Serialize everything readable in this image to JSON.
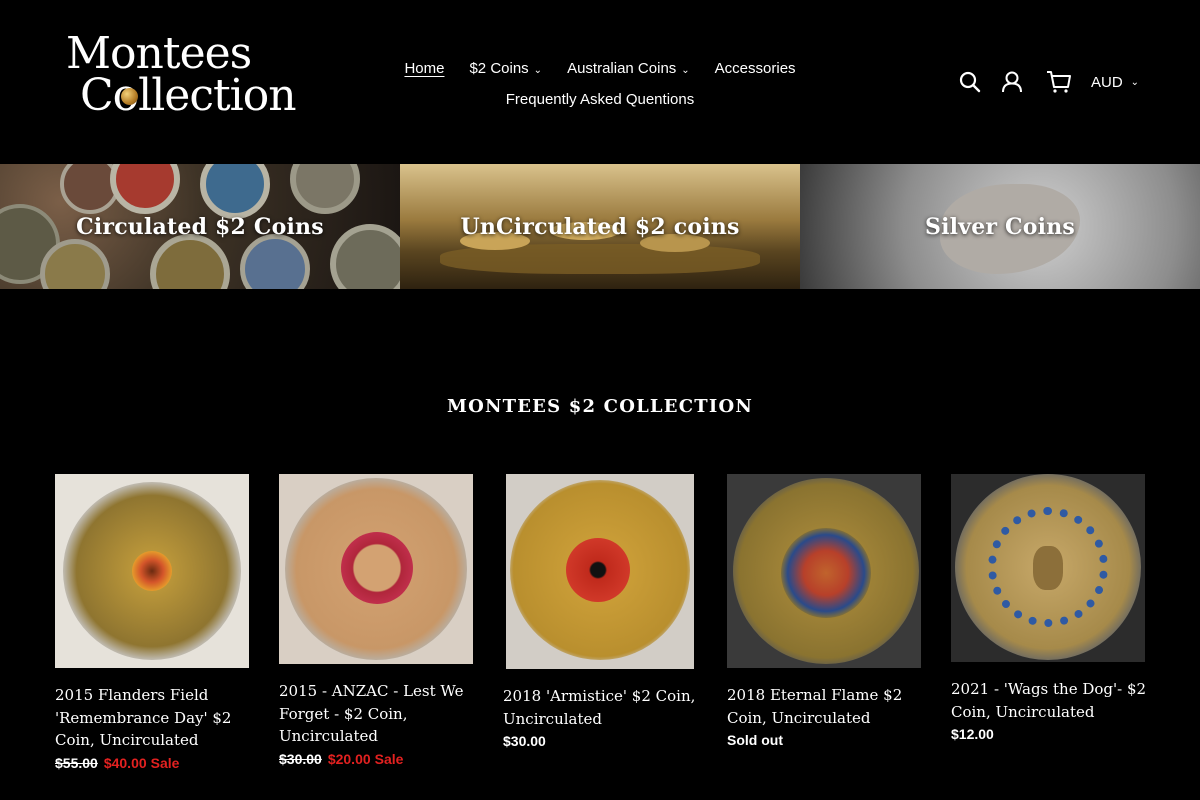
{
  "brand": {
    "line1": "Montees",
    "line2": "Collection"
  },
  "nav": {
    "row1": [
      {
        "label": "Home",
        "active": true
      },
      {
        "label": "$2 Coins",
        "dropdown": true
      },
      {
        "label": "Australian Coins",
        "dropdown": true
      },
      {
        "label": "Accessories"
      }
    ],
    "row2": [
      {
        "label": "Frequently Asked Quentions"
      }
    ]
  },
  "header_icons": [
    "search-icon",
    "user-icon",
    "cart-icon"
  ],
  "currency": {
    "value": "AUD",
    "icon": "chevron-down-icon"
  },
  "banners": [
    {
      "label": "Circulated $2 Coins"
    },
    {
      "label": "UnCirculated $2 coins"
    },
    {
      "label": "Silver Coins"
    }
  ],
  "section_title": "MONTEES $2 COLLECTION",
  "products": [
    {
      "title": "2015 Flanders Field 'Remembrance Day' $2 Coin, Uncirculated",
      "old_price": "$55.00",
      "price": "$40.00",
      "tag": "Sale"
    },
    {
      "title": "2015 - ANZAC - Lest We Forget - $2 Coin, Uncirculated",
      "old_price": "$30.00",
      "price": "$20.00",
      "tag": "Sale"
    },
    {
      "title": "2018 'Armistice' $2 Coin, Uncirculated",
      "price": "$30.00"
    },
    {
      "title": "2018 Eternal Flame $2 Coin, Uncirculated",
      "status": "Sold out"
    },
    {
      "title": "2021 - 'Wags the Dog'- $2 Coin, Uncirculated",
      "price": "$12.00"
    }
  ],
  "colors": {
    "background": "#000000",
    "text": "#ffffff",
    "sale": "#e22120"
  }
}
